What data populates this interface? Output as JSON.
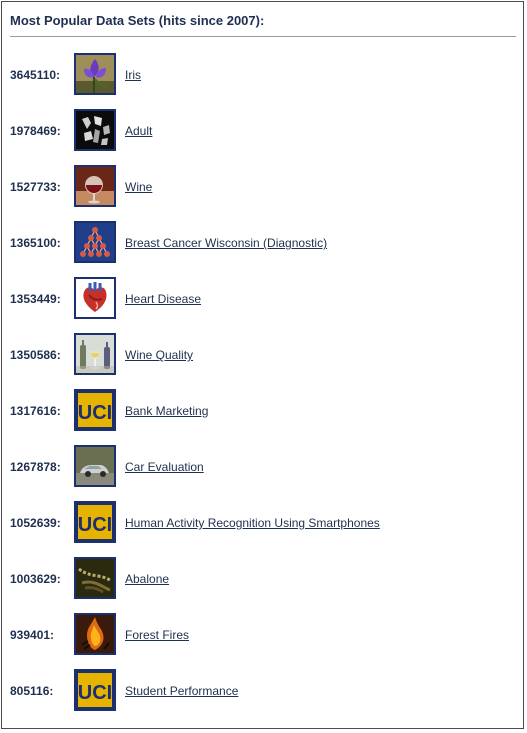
{
  "page": {
    "title": "Most Popular Data Sets (hits since 2007):"
  },
  "datasets": [
    {
      "hits": "3645110:",
      "name": "Iris",
      "image": "iris-flower-thumbnail"
    },
    {
      "hits": "1978469:",
      "name": "Adult",
      "image": "adult-thumbnail"
    },
    {
      "hits": "1527733:",
      "name": "Wine",
      "image": "wine-glass-thumbnail"
    },
    {
      "hits": "1365100:",
      "name": "Breast Cancer Wisconsin (Diagnostic)",
      "image": "network-diagram-thumbnail"
    },
    {
      "hits": "1353449:",
      "name": "Heart Disease",
      "image": "heart-anatomy-thumbnail"
    },
    {
      "hits": "1350586:",
      "name": "Wine Quality",
      "image": "wine-bottles-thumbnail"
    },
    {
      "hits": "1317616:",
      "name": "Bank Marketing",
      "image": "uci-logo-thumbnail"
    },
    {
      "hits": "1267878:",
      "name": "Car Evaluation",
      "image": "car-thumbnail"
    },
    {
      "hits": "1052639:",
      "name": "Human Activity Recognition Using Smartphones",
      "image": "uci-logo-thumbnail"
    },
    {
      "hits": "1003629:",
      "name": "Abalone",
      "image": "abalone-thumbnail"
    },
    {
      "hits": "939401:",
      "name": "Forest Fires",
      "image": "forest-fire-thumbnail"
    },
    {
      "hits": "805116:",
      "name": "Student Performance",
      "image": "uci-logo-thumbnail"
    }
  ],
  "colors": {
    "text": "#1f2f4f",
    "thumb_border": "#1c2f6e",
    "rule": "#9a9a9a",
    "uci_gold": "#e6b300",
    "uci_blue": "#1c2f6e"
  },
  "thumbnail_text": {
    "uci": "UCI"
  }
}
